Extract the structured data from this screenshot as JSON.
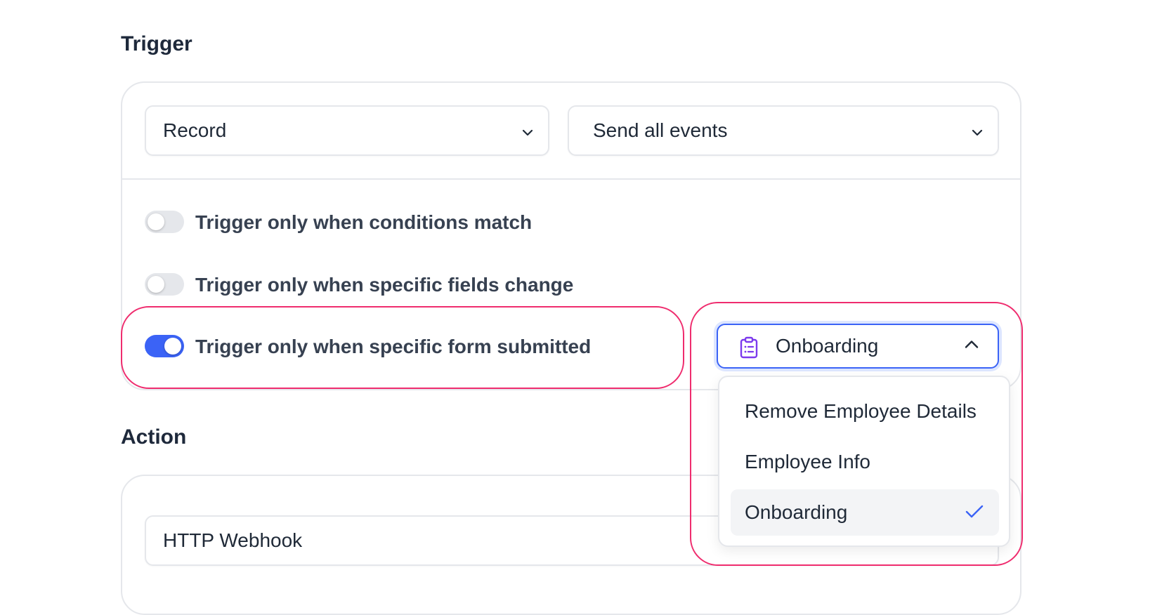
{
  "trigger": {
    "title": "Trigger",
    "record_select": "Record",
    "events_select": "Send all events",
    "toggles": [
      {
        "label": "Trigger only when conditions match",
        "enabled": false
      },
      {
        "label": "Trigger only when specific fields change",
        "enabled": false
      },
      {
        "label": "Trigger only when specific form submitted",
        "enabled": true
      }
    ],
    "form_select": {
      "value": "Onboarding",
      "icon": "clipboard-list-icon",
      "expanded": true,
      "options": [
        {
          "label": "Remove Employee Details",
          "selected": false
        },
        {
          "label": "Employee Info",
          "selected": false
        },
        {
          "label": "Onboarding",
          "selected": true
        }
      ]
    }
  },
  "action": {
    "title": "Action",
    "type_select": "HTTP Webhook"
  },
  "colors": {
    "accent": "#3b63f6",
    "highlight": "#ef2c6e",
    "icon_purple": "#7c3aed"
  }
}
